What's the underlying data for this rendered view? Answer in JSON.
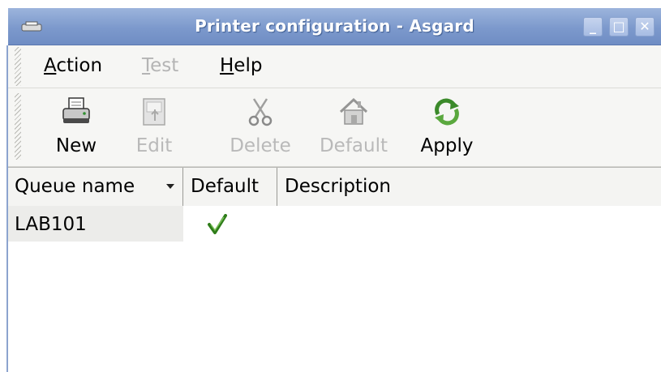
{
  "window": {
    "title": "Printer configuration - Asgard",
    "app_icon": "printer-icon",
    "controls": {
      "minimize": "_",
      "maximize": "□",
      "close": "✕"
    }
  },
  "menu": {
    "action": {
      "underline": "A",
      "rest": "ction"
    },
    "test": {
      "underline": "T",
      "rest": "est"
    },
    "help": {
      "underline": "H",
      "rest": "elp"
    }
  },
  "toolbar": {
    "new_label": "New",
    "edit_label": "Edit",
    "delete_label": "Delete",
    "default_label": "Default",
    "apply_label": "Apply"
  },
  "list": {
    "columns": [
      "Queue name",
      "Default",
      "Description"
    ],
    "rows": [
      {
        "queue_name": "LAB101",
        "is_default": true,
        "description": ""
      }
    ]
  },
  "colors": {
    "titlebar": "#7c99cc",
    "check": "#3e8a1f"
  }
}
